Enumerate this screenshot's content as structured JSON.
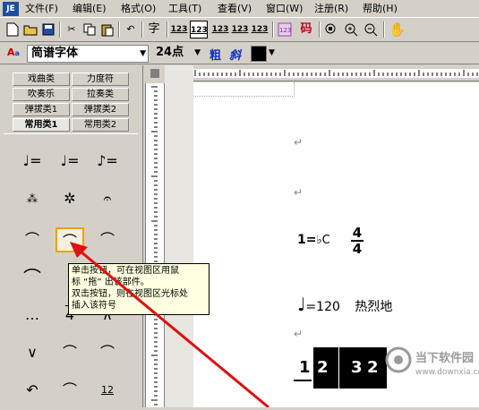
{
  "menu": {
    "items": [
      {
        "label": "文件(F)"
      },
      {
        "label": "编辑(E)"
      },
      {
        "label": "格式(O)"
      },
      {
        "label": "工具(T)"
      },
      {
        "label": "查看(V)"
      },
      {
        "label": "窗口(W)"
      },
      {
        "label": "注册(R)"
      },
      {
        "label": "帮助(H)"
      }
    ]
  },
  "app_icon": "JE",
  "toolbar": {
    "font_btn": "字",
    "num_buttons": [
      "123",
      "123",
      "123",
      "123",
      "123"
    ],
    "code_btn": "码"
  },
  "format": {
    "font_name": "简谱字体",
    "font_size": "24点",
    "bold": "粗",
    "italic": "斜",
    "text_color": "#000000"
  },
  "palette": {
    "tabs_row1": [
      "戏曲类",
      "力度符"
    ],
    "tabs_row2": [
      "吹奏乐",
      "拉奏类"
    ],
    "tabs_row3": [
      "弹拔类1",
      "弹拔类2"
    ],
    "tabs_row4": [
      "常用类1",
      "常用类2"
    ],
    "symbols": [
      "♩=",
      "♩=",
      "♪=",
      "⁂",
      "✲",
      "𝄐",
      "⌒",
      "⌒",
      "⌒",
      "⌒",
      "⌒",
      "",
      "…",
      "4",
      "∧",
      "∨",
      "⌒",
      "⌒",
      "↶",
      "⌒",
      "12"
    ]
  },
  "tooltip": {
    "lines": [
      "单击按钮，可在视图区用鼠",
      "标 “拖” 出该部件。",
      "双击按钮，则在视图区光标处",
      "插入该符号"
    ]
  },
  "document": {
    "para_mark": "↵",
    "key_line": {
      "prefix": "1=",
      "key": "♭C",
      "time_num": "4",
      "time_den": "4"
    },
    "tempo_line": {
      "note": "♩",
      "value": "=120",
      "text": "热烈地"
    },
    "notes_line": [
      "1",
      "2",
      "3",
      "2"
    ]
  },
  "watermark": {
    "title": "当下软件园",
    "url": "www.downxia.com"
  }
}
